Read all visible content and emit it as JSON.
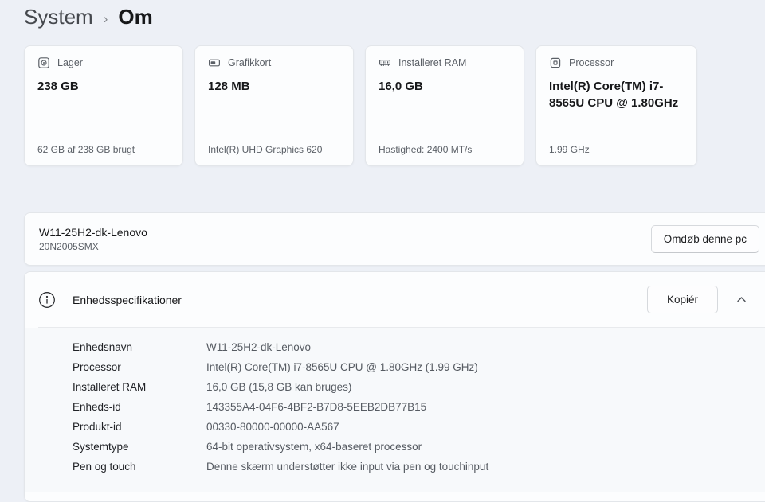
{
  "breadcrumb": {
    "parent": "System",
    "separator": "›",
    "current": "Om"
  },
  "cards": [
    {
      "icon": "storage-icon",
      "label": "Lager",
      "value": "238 GB",
      "caption": "62 GB af 238 GB brugt"
    },
    {
      "icon": "gpu-icon",
      "label": "Grafikkort",
      "value": "128 MB",
      "caption": "Intel(R) UHD Graphics 620"
    },
    {
      "icon": "ram-icon",
      "label": "Installeret RAM",
      "value": "16,0 GB",
      "caption": "Hastighed: 2400 MT/s"
    },
    {
      "icon": "cpu-icon",
      "label": "Processor",
      "value": "Intel(R) Core(TM) i7-8565U CPU @ 1.80GHz",
      "caption": "1.99 GHz"
    }
  ],
  "device": {
    "name": "W11-25H2-dk-Lenovo",
    "model": "20N2005SMX",
    "rename_button": "Omdøb denne pc"
  },
  "specs": {
    "title": "Enhedsspecifikationer",
    "copy_button": "Kopiér",
    "expander_state": "expanded",
    "rows": [
      {
        "label": "Enhedsnavn",
        "value": "W11-25H2-dk-Lenovo"
      },
      {
        "label": "Processor",
        "value": "Intel(R) Core(TM) i7-8565U CPU @ 1.80GHz (1.99 GHz)"
      },
      {
        "label": "Installeret RAM",
        "value": "16,0 GB (15,8 GB kan bruges)"
      },
      {
        "label": "Enheds-id",
        "value": "143355A4-04F6-4BF2-B7D8-5EEB2DB77B15"
      },
      {
        "label": "Produkt-id",
        "value": "00330-80000-00000-AA567"
      },
      {
        "label": "Systemtype",
        "value": "64-bit operativsystem, x64-baseret processor"
      },
      {
        "label": "Pen og touch",
        "value": "Denne skærm understøtter ikke input via pen og touchinput"
      }
    ]
  },
  "colors": {
    "page_background": "#edf0f6",
    "card_background": "#fcfdfe",
    "card_border": "#e3e6ea",
    "expanded_content_background": "#f7f9fb",
    "primary_text": "#17181a",
    "secondary_text": "#5b6067"
  }
}
